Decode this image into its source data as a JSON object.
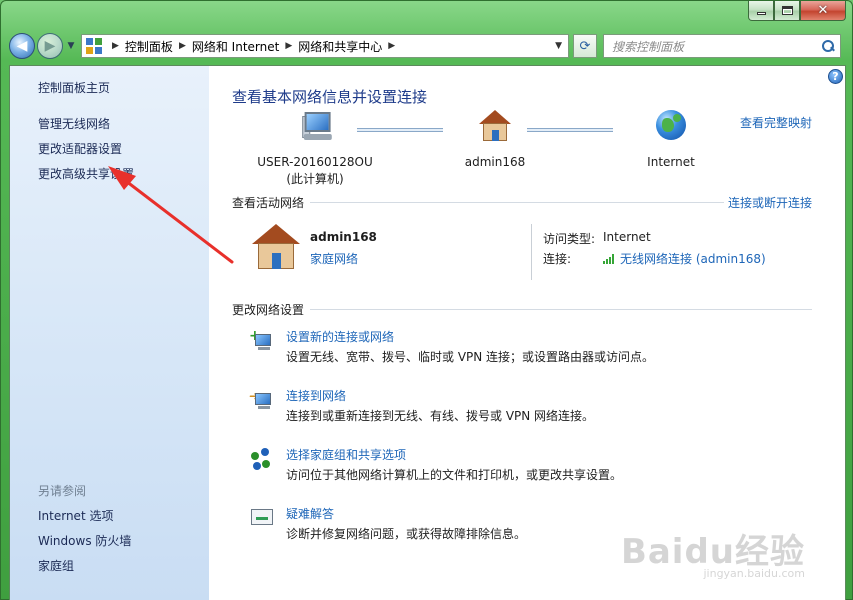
{
  "window": {
    "caption": {
      "minimize": "",
      "maximize": "",
      "close": "✕"
    }
  },
  "address_bar": {
    "crumbs": [
      "控制面板",
      "网络和 Internet",
      "网络和共享中心"
    ],
    "search_placeholder": "搜索控制面板"
  },
  "sidebar": {
    "home": "控制面板主页",
    "links": [
      "管理无线网络",
      "更改适配器设置",
      "更改高级共享设置"
    ],
    "see_also_header": "另请参阅",
    "see_also": [
      "Internet 选项",
      "Windows 防火墙",
      "家庭组"
    ]
  },
  "main": {
    "help": "?",
    "title": "查看基本网络信息并设置连接",
    "full_map_link": "查看完整映射",
    "map": {
      "pc_name": "USER-20160128OU",
      "pc_sub": "(此计算机)",
      "router_name": "admin168",
      "internet_name": "Internet"
    },
    "active_header": "查看活动网络",
    "connect_link": "连接或断开连接",
    "active": {
      "name": "admin168",
      "type": "家庭网络",
      "access_key": "访问类型:",
      "access_val": "Internet",
      "conn_key": "连接:",
      "conn_val": "无线网络连接 (admin168)"
    },
    "change_header": "更改网络设置",
    "tasks": [
      {
        "title": "设置新的连接或网络",
        "desc": "设置无线、宽带、拨号、临时或 VPN 连接；或设置路由器或访问点。"
      },
      {
        "title": "连接到网络",
        "desc": "连接到或重新连接到无线、有线、拨号或 VPN 网络连接。"
      },
      {
        "title": "选择家庭组和共享选项",
        "desc": "访问位于其他网络计算机上的文件和打印机，或更改共享设置。"
      },
      {
        "title": "疑难解答",
        "desc": "诊断并修复网络问题，或获得故障排除信息。"
      }
    ]
  },
  "watermark": {
    "brand": "Baidu经验",
    "url": "jingyan.baidu.com"
  },
  "colors": {
    "link": "#1e66b8",
    "title": "#1e3b8a",
    "frame": "#55b955",
    "annotation_arrow": "#e8302b"
  }
}
